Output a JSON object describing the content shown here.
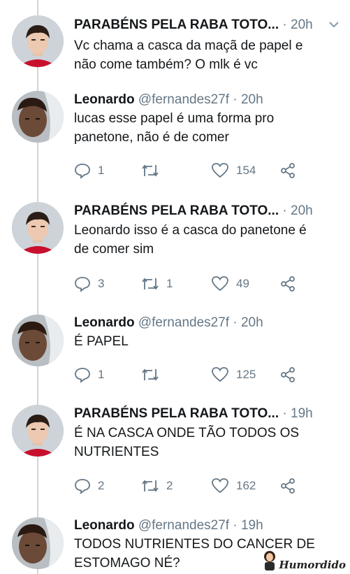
{
  "tweets": [
    {
      "author_type": "parabens",
      "name": "PARABÉNS PELA RABA TOTO...",
      "handle": "",
      "time": "20h",
      "text": [
        "Vc chama a casca da maçã de papel e",
        "não come também? O mlk é vc"
      ],
      "actions": null
    },
    {
      "author_type": "leonardo",
      "name": "Leonardo",
      "handle": "@fernandes27f",
      "time": "20h",
      "text": [
        "lucas esse papel é uma forma pro",
        "panetone, não é de comer"
      ],
      "actions": {
        "reply": "1",
        "retweet": "",
        "like": "154"
      }
    },
    {
      "author_type": "parabens",
      "name": "PARABÉNS PELA RABA TOTO...",
      "handle": "",
      "time": "20h",
      "text": [
        "Leonardo isso é a casca do panetone é",
        "de comer sim"
      ],
      "actions": {
        "reply": "3",
        "retweet": "1",
        "like": "49"
      }
    },
    {
      "author_type": "leonardo",
      "name": "Leonardo",
      "handle": "@fernandes27f",
      "time": "20h",
      "text": [
        "É PAPEL"
      ],
      "actions": {
        "reply": "1",
        "retweet": "",
        "like": "125"
      }
    },
    {
      "author_type": "parabens",
      "name": "PARABÉNS PELA RABA TOTO...",
      "handle": "",
      "time": "19h",
      "text": [
        "É NA CASCA ONDE TÃO TODOS OS",
        "NUTRIENTES"
      ],
      "actions": {
        "reply": "2",
        "retweet": "2",
        "like": "162"
      }
    },
    {
      "author_type": "leonardo",
      "name": "Leonardo",
      "handle": "@fernandes27f",
      "time": "19h",
      "text": [
        "TODOS NUTRIENTES DO CANCER DE",
        "ESTOMAGO NÉ?"
      ],
      "actions": null
    }
  ],
  "watermark": "Humordido",
  "icons": {
    "reply": "reply-icon",
    "retweet": "retweet-icon",
    "like": "heart-icon",
    "share": "share-icon",
    "more": "chevron-down-icon"
  },
  "colors": {
    "text": "#14171a",
    "muted": "#657786",
    "thread": "#ccd6dd"
  }
}
